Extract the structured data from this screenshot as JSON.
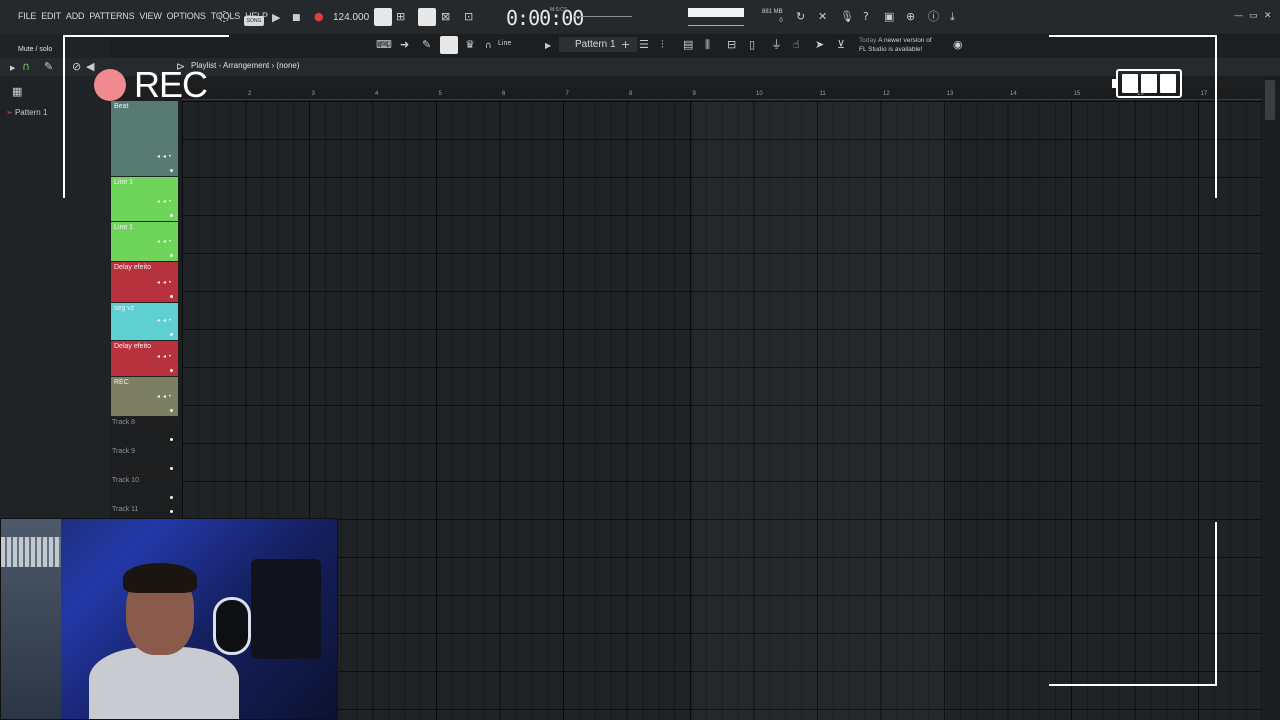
{
  "menu": [
    "FILE",
    "EDIT",
    "ADD",
    "PATTERNS",
    "VIEW",
    "OPTIONS",
    "TOOLS",
    "HELP"
  ],
  "transport": {
    "song_label": "SONG",
    "tempo": "124.000",
    "time": "0:00:00",
    "time_unit": "M:S:CS"
  },
  "system": {
    "memory": "881 MB",
    "cpu": "0"
  },
  "update_notice": {
    "when": "Today",
    "text1": "A newer version of",
    "text2": "FL Studio is available!"
  },
  "toolbar": {
    "snap": "Line",
    "pattern": "Pattern 1"
  },
  "browser": {
    "hint": "Mute / solo",
    "item": "Pattern 1"
  },
  "playlist": {
    "title": "Playlist - Arrangement",
    "sep": "›",
    "current": "(none)"
  },
  "ruler": [
    "2",
    "3",
    "4",
    "5",
    "6",
    "7",
    "8",
    "9",
    "10",
    "11",
    "12",
    "13",
    "14",
    "15",
    "16",
    "17"
  ],
  "tracks": [
    {
      "name": "Beat",
      "color": "#577a73"
    },
    {
      "name": "Line 1",
      "color": "#6fd45a"
    },
    {
      "name": "Line 1",
      "color": "#6fd45a"
    },
    {
      "name": "Delay efeito",
      "color": "#b8323d"
    },
    {
      "name": "seg vz",
      "color": "#5fd0d2"
    },
    {
      "name": "Delay efeito",
      "color": "#b8323d"
    },
    {
      "name": "REC",
      "color": "#7d7f63"
    },
    {
      "name": "Track 8",
      "color": ""
    },
    {
      "name": "Track 9",
      "color": ""
    },
    {
      "name": "Track 10",
      "color": ""
    },
    {
      "name": "Track 11",
      "color": ""
    }
  ],
  "overlay": {
    "rec_label": "REC",
    "rec_color": "#f08a8e"
  }
}
